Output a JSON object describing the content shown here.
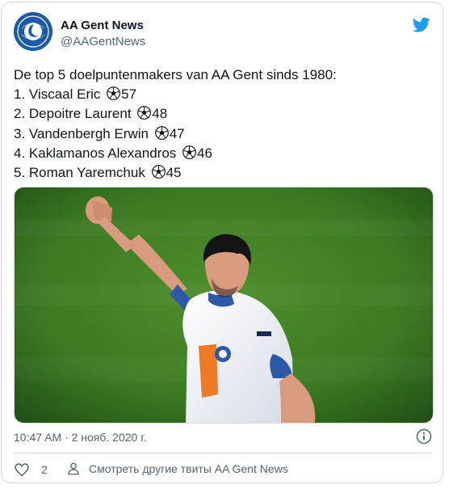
{
  "tweet": {
    "author_name": "AA Gent News",
    "author_handle": "@AAGentNews",
    "lines": [
      {
        "text": "De top 5 doelpuntenmakers van AA Gent sinds 1980:",
        "goals": null
      },
      {
        "text": "1. Viscaal Eric ",
        "goals": "57"
      },
      {
        "text": "2. Depoitre Laurent ",
        "goals": "48"
      },
      {
        "text": "3. Vandenbergh Erwin ",
        "goals": "47"
      },
      {
        "text": "4. Kaklamanos Alexandros ",
        "goals": "46"
      },
      {
        "text": "5. Roman Yaremchuk ",
        "goals": "45"
      }
    ],
    "timestamp": "10:47 AM · 2 нояб. 2020 г.",
    "like_count": "2",
    "more_tweets_label": "Смотреть другие твиты AA Gent News"
  },
  "icons": {
    "logo": "twitter-bird-icon",
    "line_emoji": "soccer-ball-icon",
    "info": "info-icon",
    "like": "heart-icon",
    "profile": "person-icon"
  },
  "colors": {
    "twitter_blue": "#1d9bf0",
    "avatar_blue": "#1d5aa6",
    "text_primary": "#0f1419",
    "text_secondary": "#536471",
    "border": "#cfd9de"
  }
}
